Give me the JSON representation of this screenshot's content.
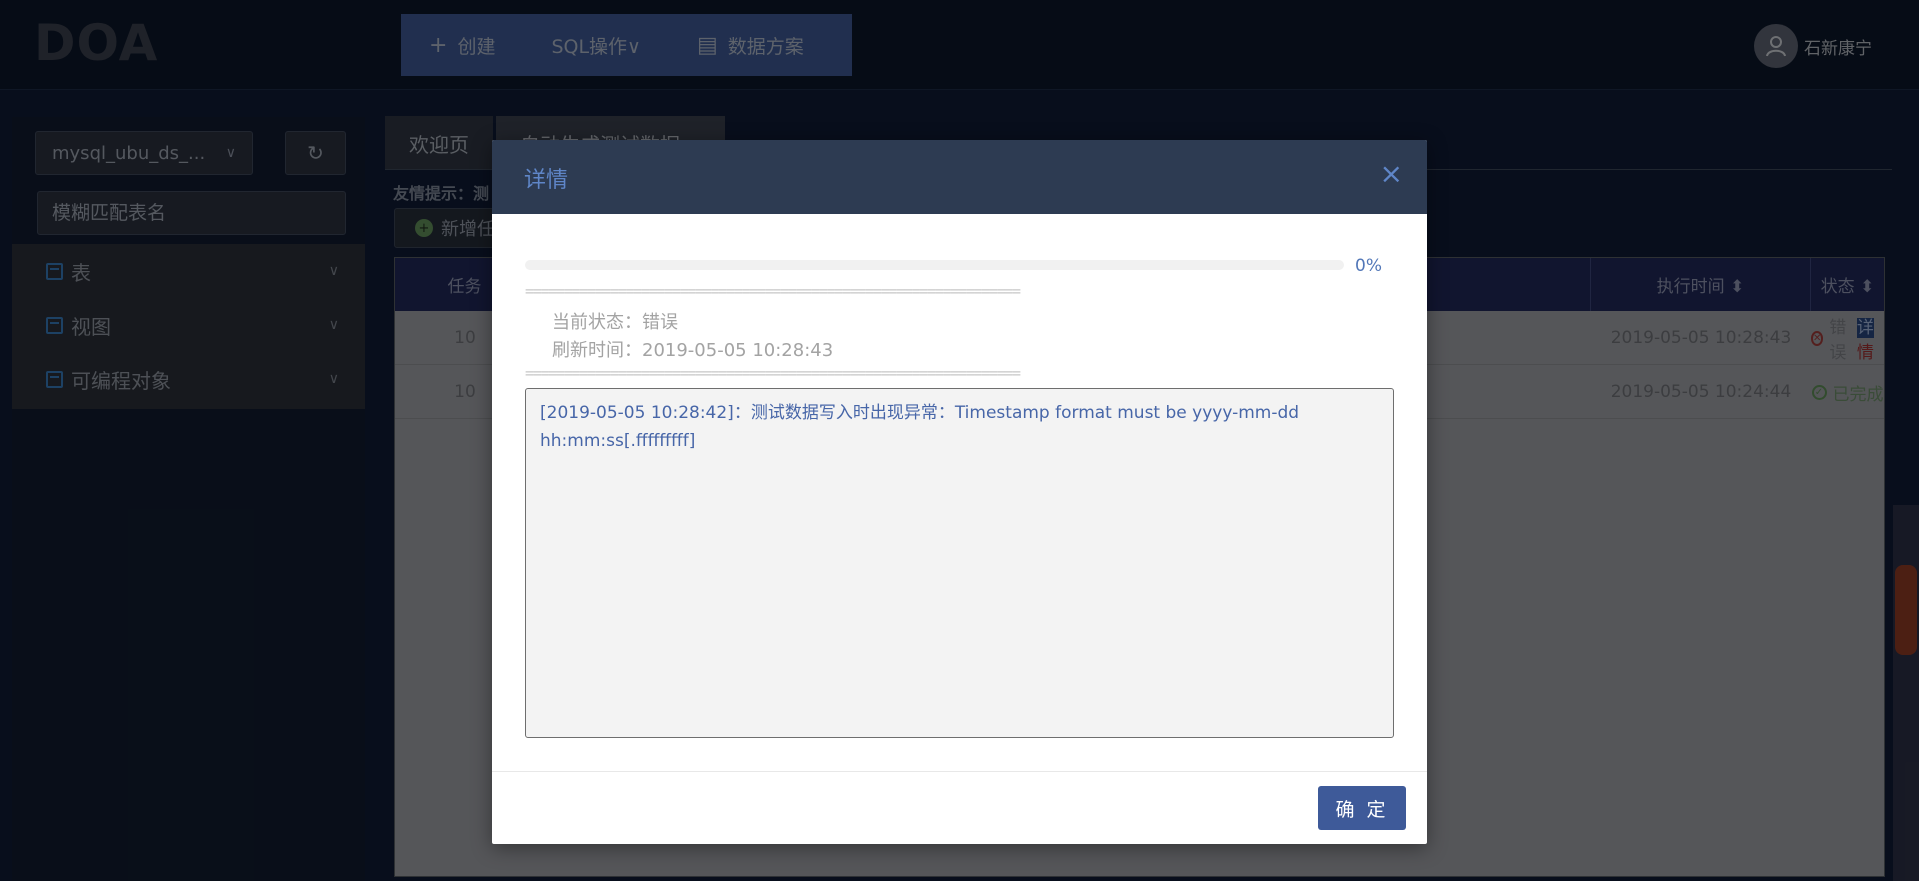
{
  "header": {
    "logo": "DOA",
    "nav": [
      {
        "icon": "plus-icon",
        "label": "创建"
      },
      {
        "icon": "",
        "label": "SQL操作∨"
      },
      {
        "icon": "document-icon",
        "label": "数据方案"
      }
    ],
    "user_name": "石新康宁"
  },
  "sidebar": {
    "db_select_value": "mysql_ubu_ds_...",
    "search_placeholder": "模糊匹配表名",
    "tree": [
      {
        "label": "表"
      },
      {
        "label": "视图"
      },
      {
        "label": "可编程对象"
      }
    ]
  },
  "main": {
    "tabs": [
      {
        "label": "欢迎页"
      },
      {
        "label": "自动生成测试数据 ∨"
      }
    ],
    "hint": "友情提示：测",
    "add_button": "新增任",
    "table": {
      "headers": [
        "任务",
        "",
        "执行时间 ⬍",
        "状态 ⬍"
      ],
      "rows": [
        {
          "id": "10",
          "time": "2019-05-05 10:28:43",
          "status": "错误",
          "detail_a": "详",
          "detail_b": "情"
        },
        {
          "id": "10",
          "time": "2019-05-05 10:24:44",
          "status": "已完成"
        }
      ]
    }
  },
  "modal": {
    "title": "详情",
    "close": "×",
    "progress_percent": 0,
    "progress_label": "0%",
    "separator": "================================================================",
    "status_label": "当前状态：错误",
    "refresh_label": "刷新时间：2019-05-05 10:28:43",
    "log": "[2019-05-05 10:28:42]：测试数据写入时出现异常：Timestamp format must be yyyy-mm-dd hh:mm:ss[.fffffffff]",
    "ok_button": "确 定"
  },
  "colors": {
    "accent": "#3e5a99",
    "modal_header": "#2d3b52",
    "title_blue": "#5f86c8",
    "log_text": "#4766a8"
  }
}
